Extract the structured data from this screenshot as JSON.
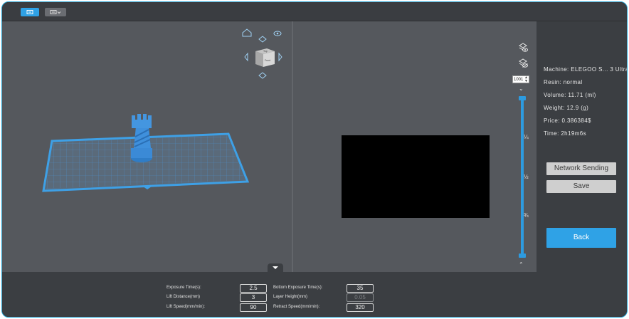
{
  "colors": {
    "accent": "#2fa2e6",
    "background": "#3d4044",
    "viewport": "#55585d",
    "model": "#3f8fd8"
  },
  "toolbar": {
    "buttons": [
      {
        "name": "slice-view-button",
        "icon": "layers-icon",
        "active": true
      },
      {
        "name": "model-view-button",
        "icon": "layers-dropdown-icon",
        "active": false
      }
    ]
  },
  "viewport3d": {
    "view_cube": {
      "top_face": "Top",
      "front_face": "Front"
    }
  },
  "layer_preview": {
    "layer_number": "1001",
    "fractions": [
      "¼",
      "½",
      "¾"
    ]
  },
  "info": {
    "machine": "Machine:  ELEGOO S... 3 Ultra",
    "resin": "Resin:  normal",
    "volume": "Volume:  11.71  (ml)",
    "weight": "Weight:  12.9  (g)",
    "price": "Price:  0.386384$",
    "time": "Time:  2h19m6s"
  },
  "actions": {
    "network_sending": "Network Sending",
    "save": "Save",
    "back": "Back"
  },
  "params": {
    "exposure_time_label": "Exposure Time(s):",
    "exposure_time": "2.5",
    "lift_distance_label": "Lift Distance(mm)",
    "lift_distance": "3",
    "lift_speed_label": "Lift Speed(mm/min):",
    "lift_speed": "90",
    "bottom_exposure_label": "Bottom Exposure Time(s):",
    "bottom_exposure": "35",
    "layer_height_label": "Layer Height(mm)",
    "layer_height": "0.05",
    "retract_speed_label": "Retract Speed(mm/min):",
    "retract_speed": "320"
  }
}
